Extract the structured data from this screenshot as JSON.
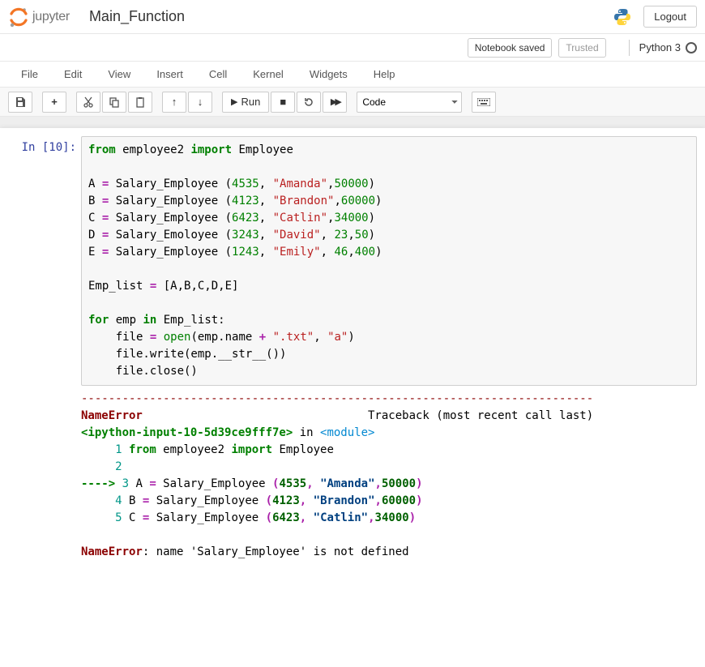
{
  "header": {
    "logo_text": "jupyter",
    "notebook_title": "Main_Function",
    "logout_label": "Logout"
  },
  "notif": {
    "saved_msg": "Notebook saved",
    "trusted": "Trusted",
    "kernel_name": "Python 3"
  },
  "menus": [
    "File",
    "Edit",
    "View",
    "Insert",
    "Cell",
    "Kernel",
    "Widgets",
    "Help"
  ],
  "toolbar": {
    "run_label": "Run",
    "cell_type": "Code"
  },
  "cell": {
    "prompt": "In [10]:",
    "code_tokens": [
      {
        "t": "from",
        "c": "kw"
      },
      {
        "t": " employee2 ",
        "c": "nm"
      },
      {
        "t": "import",
        "c": "kw"
      },
      {
        "t": " Employee\n\n",
        "c": "nm"
      },
      {
        "t": "A ",
        "c": "nm"
      },
      {
        "t": "=",
        "c": "op"
      },
      {
        "t": " Salary_Employee (",
        "c": "nm"
      },
      {
        "t": "4535",
        "c": "num"
      },
      {
        "t": ", ",
        "c": "nm"
      },
      {
        "t": "\"Amanda\"",
        "c": "str"
      },
      {
        "t": ",",
        "c": "nm"
      },
      {
        "t": "50000",
        "c": "num"
      },
      {
        "t": ")\n",
        "c": "nm"
      },
      {
        "t": "B ",
        "c": "nm"
      },
      {
        "t": "=",
        "c": "op"
      },
      {
        "t": " Salary_Employee (",
        "c": "nm"
      },
      {
        "t": "4123",
        "c": "num"
      },
      {
        "t": ", ",
        "c": "nm"
      },
      {
        "t": "\"Brandon\"",
        "c": "str"
      },
      {
        "t": ",",
        "c": "nm"
      },
      {
        "t": "60000",
        "c": "num"
      },
      {
        "t": ")\n",
        "c": "nm"
      },
      {
        "t": "C ",
        "c": "nm"
      },
      {
        "t": "=",
        "c": "op"
      },
      {
        "t": " Salary_Employee (",
        "c": "nm"
      },
      {
        "t": "6423",
        "c": "num"
      },
      {
        "t": ", ",
        "c": "nm"
      },
      {
        "t": "\"Catlin\"",
        "c": "str"
      },
      {
        "t": ",",
        "c": "nm"
      },
      {
        "t": "34000",
        "c": "num"
      },
      {
        "t": ")\n",
        "c": "nm"
      },
      {
        "t": "D ",
        "c": "nm"
      },
      {
        "t": "=",
        "c": "op"
      },
      {
        "t": " Salary_Emoloyee (",
        "c": "nm"
      },
      {
        "t": "3243",
        "c": "num"
      },
      {
        "t": ", ",
        "c": "nm"
      },
      {
        "t": "\"David\"",
        "c": "str"
      },
      {
        "t": ", ",
        "c": "nm"
      },
      {
        "t": "23",
        "c": "num"
      },
      {
        "t": ",",
        "c": "nm"
      },
      {
        "t": "50",
        "c": "num"
      },
      {
        "t": ")\n",
        "c": "nm"
      },
      {
        "t": "E ",
        "c": "nm"
      },
      {
        "t": "=",
        "c": "op"
      },
      {
        "t": " Salary_Employee (",
        "c": "nm"
      },
      {
        "t": "1243",
        "c": "num"
      },
      {
        "t": ", ",
        "c": "nm"
      },
      {
        "t": "\"Emily\"",
        "c": "str"
      },
      {
        "t": ", ",
        "c": "nm"
      },
      {
        "t": "46",
        "c": "num"
      },
      {
        "t": ",",
        "c": "nm"
      },
      {
        "t": "400",
        "c": "num"
      },
      {
        "t": ")\n\n",
        "c": "nm"
      },
      {
        "t": "Emp_list ",
        "c": "nm"
      },
      {
        "t": "=",
        "c": "op"
      },
      {
        "t": " [A,B,C,D,E]\n\n",
        "c": "nm"
      },
      {
        "t": "for",
        "c": "kw"
      },
      {
        "t": " emp ",
        "c": "nm"
      },
      {
        "t": "in",
        "c": "kw"
      },
      {
        "t": " Emp_list:\n",
        "c": "nm"
      },
      {
        "t": "    file ",
        "c": "nm"
      },
      {
        "t": "=",
        "c": "op"
      },
      {
        "t": " ",
        "c": "nm"
      },
      {
        "t": "open",
        "c": "builtin"
      },
      {
        "t": "(emp.name ",
        "c": "nm"
      },
      {
        "t": "+",
        "c": "op"
      },
      {
        "t": " ",
        "c": "nm"
      },
      {
        "t": "\".txt\"",
        "c": "str"
      },
      {
        "t": ", ",
        "c": "nm"
      },
      {
        "t": "\"a\"",
        "c": "str"
      },
      {
        "t": ")\n",
        "c": "nm"
      },
      {
        "t": "    file.write(emp.__str__())\n",
        "c": "nm"
      },
      {
        "t": "    file.close()",
        "c": "nm"
      }
    ]
  },
  "traceback": {
    "dash_line": "---------------------------------------------------------------------------",
    "err_name": "NameError",
    "trace_header": "Traceback (most recent call last)",
    "loc": "<ipython-input-10-5d39ce9fff7e>",
    "in_word": " in ",
    "module": "<module>",
    "lines": [
      {
        "arrow": "     ",
        "n": "1",
        "tokens": [
          {
            "t": " ",
            "c": "tb-plain"
          },
          {
            "t": "from",
            "c": "kw"
          },
          {
            "t": " employee2 ",
            "c": "tb-plain"
          },
          {
            "t": "import",
            "c": "kw"
          },
          {
            "t": " Employee",
            "c": "tb-plain"
          }
        ]
      },
      {
        "arrow": "     ",
        "n": "2",
        "tokens": [
          {
            "t": " ",
            "c": "tb-plain"
          }
        ]
      },
      {
        "arrow": "----> ",
        "n": "3",
        "tokens": [
          {
            "t": " A ",
            "c": "tb-plain"
          },
          {
            "t": "=",
            "c": "op"
          },
          {
            "t": " Salary_Employee ",
            "c": "tb-plain"
          },
          {
            "t": "(",
            "c": "op"
          },
          {
            "t": "4535",
            "c": "tb-bold-num"
          },
          {
            "t": ",",
            "c": "op"
          },
          {
            "t": " ",
            "c": "tb-plain"
          },
          {
            "t": "\"Amanda\"",
            "c": "tb-bold-str"
          },
          {
            "t": ",",
            "c": "op"
          },
          {
            "t": "50000",
            "c": "tb-bold-num"
          },
          {
            "t": ")",
            "c": "op"
          }
        ]
      },
      {
        "arrow": "     ",
        "n": "4",
        "tokens": [
          {
            "t": " B ",
            "c": "tb-plain"
          },
          {
            "t": "=",
            "c": "op"
          },
          {
            "t": " Salary_Employee ",
            "c": "tb-plain"
          },
          {
            "t": "(",
            "c": "op"
          },
          {
            "t": "4123",
            "c": "tb-bold-num"
          },
          {
            "t": ",",
            "c": "op"
          },
          {
            "t": " ",
            "c": "tb-plain"
          },
          {
            "t": "\"Brandon\"",
            "c": "tb-bold-str"
          },
          {
            "t": ",",
            "c": "op"
          },
          {
            "t": "60000",
            "c": "tb-bold-num"
          },
          {
            "t": ")",
            "c": "op"
          }
        ]
      },
      {
        "arrow": "     ",
        "n": "5",
        "tokens": [
          {
            "t": " C ",
            "c": "tb-plain"
          },
          {
            "t": "=",
            "c": "op"
          },
          {
            "t": " Salary_Employee ",
            "c": "tb-plain"
          },
          {
            "t": "(",
            "c": "op"
          },
          {
            "t": "6423",
            "c": "tb-bold-num"
          },
          {
            "t": ",",
            "c": "op"
          },
          {
            "t": " ",
            "c": "tb-plain"
          },
          {
            "t": "\"Catlin\"",
            "c": "tb-bold-str"
          },
          {
            "t": ",",
            "c": "op"
          },
          {
            "t": "34000",
            "c": "tb-bold-num"
          },
          {
            "t": ")",
            "c": "op"
          }
        ]
      }
    ],
    "final_err": "NameError",
    "final_msg": ": name 'Salary_Employee' is not defined"
  }
}
